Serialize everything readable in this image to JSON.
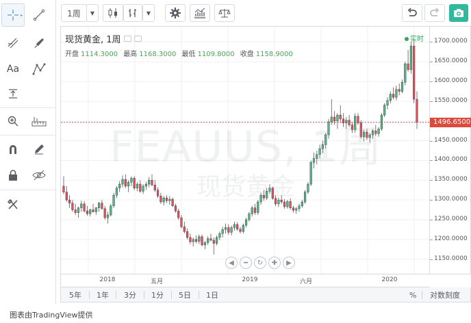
{
  "toolbar": {
    "interval_label": "1周",
    "icons": [
      "candles-icon",
      "indicators-icon",
      "settings-gear-icon",
      "compare-icon",
      "scale-icon",
      "undo-icon",
      "redo-icon",
      "camera-icon"
    ]
  },
  "left_toolbar": {
    "text_tool_label": "Aa",
    "icons": [
      "crosshair-icon",
      "trend-line-icon",
      "fib-icon",
      "brush-icon",
      "text-icon",
      "pattern-icon",
      "measure-icon",
      "zoom-icon",
      "ruler-icon",
      "magnet-icon",
      "pencil-lock-icon",
      "lock-icon",
      "eye-hide-icon",
      "remove-tools-icon"
    ]
  },
  "legend": {
    "title": "现货黄金, 1周",
    "open_label": "开盘",
    "open": "1114.3000",
    "high_label": "最高",
    "high": "1168.3000",
    "low_label": "最低",
    "low": "1109.8000",
    "close_label": "收盘",
    "close": "1158.9000"
  },
  "realtime_label": "实时",
  "watermark": {
    "symbol": "FEAUUS, 1周",
    "name": "现货黄金"
  },
  "price_axis": {
    "ticks": [
      "1700.0000",
      "1650.0000",
      "1600.0000",
      "1550.0000",
      "1450.0000",
      "1400.0000",
      "1350.0000",
      "1300.0000",
      "1250.0000",
      "1200.0000",
      "1150.0000"
    ],
    "last_price": "1496.6500"
  },
  "time_axis": {
    "ticks": [
      "2018",
      "五月",
      "2019",
      "六月",
      "2020"
    ]
  },
  "range_bar": {
    "ranges": [
      "5年",
      "1年",
      "3分",
      "1分",
      "5日",
      "1日"
    ],
    "percent": "%",
    "log_label": "对数刻度"
  },
  "footer": "图表由TradingView提供",
  "colors": {
    "up": "#53b987",
    "down": "#eb4d5c",
    "accent": "#30b99c",
    "last_price": "#dc4a3d"
  },
  "chart_data": {
    "type": "candlestick",
    "ylim": [
      1120,
      1725
    ],
    "candles": [
      [
        1335,
        1360,
        1315,
        1320
      ],
      [
        1320,
        1335,
        1295,
        1300
      ],
      [
        1300,
        1312,
        1280,
        1292
      ],
      [
        1292,
        1300,
        1270,
        1275
      ],
      [
        1275,
        1290,
        1262,
        1268
      ],
      [
        1268,
        1283,
        1255,
        1280
      ],
      [
        1280,
        1298,
        1270,
        1290
      ],
      [
        1290,
        1297,
        1268,
        1272
      ],
      [
        1272,
        1285,
        1260,
        1265
      ],
      [
        1265,
        1278,
        1258,
        1275
      ],
      [
        1275,
        1290,
        1268,
        1270
      ],
      [
        1270,
        1282,
        1262,
        1280
      ],
      [
        1280,
        1295,
        1270,
        1292
      ],
      [
        1292,
        1300,
        1275,
        1278
      ],
      [
        1278,
        1285,
        1250,
        1255
      ],
      [
        1255,
        1270,
        1240,
        1262
      ],
      [
        1262,
        1290,
        1258,
        1285
      ],
      [
        1285,
        1318,
        1280,
        1312
      ],
      [
        1312,
        1335,
        1305,
        1330
      ],
      [
        1330,
        1348,
        1320,
        1340
      ],
      [
        1340,
        1362,
        1332,
        1352
      ],
      [
        1352,
        1365,
        1330,
        1335
      ],
      [
        1335,
        1350,
        1320,
        1345
      ],
      [
        1345,
        1360,
        1335,
        1355
      ],
      [
        1355,
        1360,
        1325,
        1330
      ],
      [
        1330,
        1345,
        1322,
        1340
      ],
      [
        1340,
        1350,
        1318,
        1322
      ],
      [
        1322,
        1340,
        1315,
        1335
      ],
      [
        1335,
        1346,
        1325,
        1340
      ],
      [
        1340,
        1358,
        1332,
        1350
      ],
      [
        1350,
        1365,
        1335,
        1338
      ],
      [
        1338,
        1350,
        1320,
        1325
      ],
      [
        1325,
        1332,
        1305,
        1310
      ],
      [
        1310,
        1318,
        1290,
        1295
      ],
      [
        1295,
        1310,
        1286,
        1305
      ],
      [
        1305,
        1312,
        1292,
        1298
      ],
      [
        1298,
        1310,
        1288,
        1302
      ],
      [
        1302,
        1306,
        1282,
        1285
      ],
      [
        1285,
        1290,
        1268,
        1272
      ],
      [
        1272,
        1278,
        1250,
        1255
      ],
      [
        1255,
        1262,
        1228,
        1232
      ],
      [
        1232,
        1245,
        1215,
        1220
      ],
      [
        1220,
        1228,
        1200,
        1205
      ],
      [
        1205,
        1215,
        1188,
        1194
      ],
      [
        1194,
        1205,
        1182,
        1200
      ],
      [
        1200,
        1210,
        1190,
        1195
      ],
      [
        1195,
        1212,
        1188,
        1207
      ],
      [
        1207,
        1212,
        1182,
        1186
      ],
      [
        1186,
        1196,
        1175,
        1192
      ],
      [
        1192,
        1208,
        1186,
        1202
      ],
      [
        1202,
        1215,
        1195,
        1198
      ],
      [
        1198,
        1205,
        1162,
        1190
      ],
      [
        1190,
        1210,
        1185,
        1205
      ],
      [
        1205,
        1220,
        1198,
        1215
      ],
      [
        1215,
        1232,
        1205,
        1225
      ],
      [
        1225,
        1240,
        1215,
        1230
      ],
      [
        1230,
        1238,
        1212,
        1218
      ],
      [
        1218,
        1235,
        1210,
        1230
      ],
      [
        1230,
        1245,
        1222,
        1238
      ],
      [
        1238,
        1244,
        1222,
        1226
      ],
      [
        1226,
        1232,
        1215,
        1220
      ],
      [
        1220,
        1240,
        1215,
        1236
      ],
      [
        1236,
        1255,
        1230,
        1250
      ],
      [
        1250,
        1270,
        1245,
        1265
      ],
      [
        1265,
        1285,
        1258,
        1280
      ],
      [
        1280,
        1290,
        1262,
        1268
      ],
      [
        1268,
        1300,
        1262,
        1295
      ],
      [
        1295,
        1318,
        1288,
        1312
      ],
      [
        1312,
        1325,
        1298,
        1305
      ],
      [
        1305,
        1330,
        1300,
        1322
      ],
      [
        1322,
        1340,
        1315,
        1330
      ],
      [
        1330,
        1334,
        1300,
        1304
      ],
      [
        1304,
        1312,
        1285,
        1290
      ],
      [
        1290,
        1306,
        1282,
        1300
      ],
      [
        1300,
        1312,
        1290,
        1295
      ],
      [
        1295,
        1302,
        1278,
        1283
      ],
      [
        1283,
        1300,
        1278,
        1296
      ],
      [
        1296,
        1304,
        1275,
        1280
      ],
      [
        1280,
        1285,
        1268,
        1274
      ],
      [
        1274,
        1282,
        1265,
        1278
      ],
      [
        1278,
        1290,
        1270,
        1285
      ],
      [
        1285,
        1300,
        1280,
        1295
      ],
      [
        1295,
        1325,
        1290,
        1320
      ],
      [
        1320,
        1345,
        1315,
        1340
      ],
      [
        1340,
        1400,
        1335,
        1395
      ],
      [
        1395,
        1420,
        1380,
        1405
      ],
      [
        1405,
        1425,
        1390,
        1415
      ],
      [
        1415,
        1440,
        1405,
        1430
      ],
      [
        1430,
        1450,
        1418,
        1440
      ],
      [
        1440,
        1470,
        1430,
        1465
      ],
      [
        1465,
        1505,
        1455,
        1498
      ],
      [
        1498,
        1555,
        1490,
        1510
      ],
      [
        1510,
        1525,
        1490,
        1500
      ],
      [
        1500,
        1520,
        1480,
        1515
      ],
      [
        1515,
        1540,
        1495,
        1505
      ],
      [
        1505,
        1520,
        1485,
        1495
      ],
      [
        1495,
        1510,
        1480,
        1502
      ],
      [
        1502,
        1515,
        1485,
        1490
      ],
      [
        1490,
        1498,
        1470,
        1478
      ],
      [
        1478,
        1520,
        1470,
        1512
      ],
      [
        1512,
        1520,
        1490,
        1495
      ],
      [
        1495,
        1502,
        1455,
        1460
      ],
      [
        1460,
        1478,
        1448,
        1472
      ],
      [
        1472,
        1480,
        1452,
        1458
      ],
      [
        1458,
        1470,
        1445,
        1465
      ],
      [
        1465,
        1480,
        1455,
        1475
      ],
      [
        1475,
        1490,
        1462,
        1468
      ],
      [
        1468,
        1485,
        1460,
        1480
      ],
      [
        1480,
        1520,
        1475,
        1515
      ],
      [
        1515,
        1545,
        1510,
        1540
      ],
      [
        1540,
        1560,
        1530,
        1552
      ],
      [
        1552,
        1575,
        1545,
        1568
      ],
      [
        1568,
        1585,
        1555,
        1560
      ],
      [
        1560,
        1590,
        1552,
        1580
      ],
      [
        1580,
        1595,
        1565,
        1575
      ],
      [
        1575,
        1605,
        1570,
        1598
      ],
      [
        1598,
        1650,
        1590,
        1645
      ],
      [
        1645,
        1680,
        1625,
        1630
      ],
      [
        1630,
        1700,
        1620,
        1690
      ],
      [
        1690,
        1705,
        1545,
        1555
      ],
      [
        1555,
        1575,
        1480,
        1496.65
      ]
    ]
  }
}
